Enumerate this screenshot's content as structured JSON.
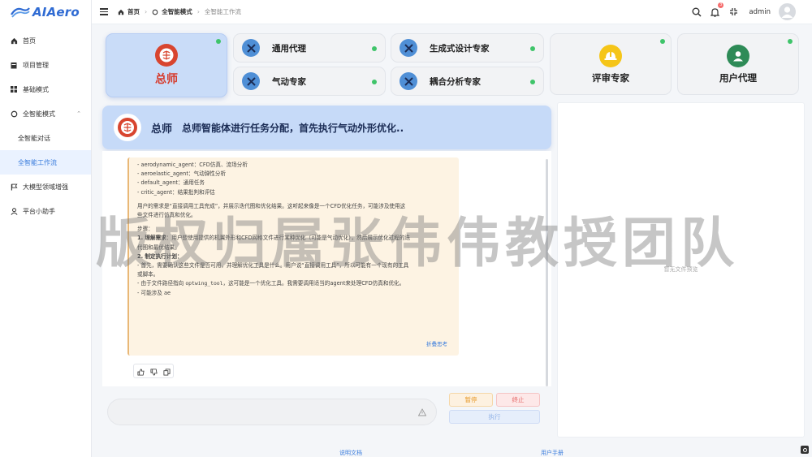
{
  "brand": {
    "name": "AIAero"
  },
  "sidebar": {
    "items": [
      {
        "label": "首页",
        "icon": "home-icon"
      },
      {
        "label": "项目管理",
        "icon": "calendar-icon"
      },
      {
        "label": "基础模式",
        "icon": "grid-icon"
      },
      {
        "label": "全智能模式",
        "icon": "circle-icon"
      },
      {
        "label": "全智能对话"
      },
      {
        "label": "全智能工作流"
      },
      {
        "label": "大模型领域增强",
        "icon": "flag-icon"
      },
      {
        "label": "平台小助手",
        "icon": "user-icon"
      }
    ]
  },
  "topbar": {
    "breadcrumbs": [
      "首页",
      "全智能模式",
      "全智能工作流"
    ],
    "notification_count": "3",
    "username": "admin"
  },
  "agents": {
    "master": "总师",
    "general": "通用代理",
    "aero": "气动专家",
    "gen_design": "生成式设计专家",
    "coupling": "耦合分析专家",
    "review": "评审专家",
    "user": "用户代理"
  },
  "chat": {
    "header_name": "总师",
    "header_text": "总师智能体进行任务分配，首先执行气动外形优化..",
    "lines": {
      "l1": "- aerodynamic_agent：CFD仿真、流场分析",
      "l2": "- aeroelastic_agent：气动弹性分析",
      "l3": "- default_agent：通用任务",
      "l4": "- critic_agent：结果批判和评估",
      "l5": "用户的需求是“直接调用工具完成”，并展示迭代图和优化结果。这听起来像是一个CFD优化任务，可能涉及使用这",
      "l6": "些文件进行仿真和优化。",
      "l7": "步骤：",
      "l8a": "1. 理解需求",
      "l8b": "：用户想使用提供的机翼外形和CFD网格文件进行某种优化（可能是气动优化），然后展示优化过程的迭",
      "l9": "代图和最优结果。",
      "l10": "2. 制定执行计划：",
      "l11": "- 首先，需要确认这些文件是否可用，并理解优化工具是什么。用户说“直接调用工具”，所以可能有一个现有的工具",
      "l12": "或脚本。",
      "l13a": "- 由于文件路径指向 ",
      "l13b": "optwing_tool",
      "l13c": "，这可能是一个优化工具。我需要调用适当的agent来处理CFD仿真和优化。",
      "l14": "- 可能涉及 ae",
      "footer": "折叠思考"
    }
  },
  "controls": {
    "input_placeholder": "",
    "pause": "暂停",
    "stop": "终止",
    "run": "执行"
  },
  "preview": {
    "placeholder": "暂无文件预览"
  },
  "footer": {
    "docs": "说明文档",
    "manual": "用户手册"
  },
  "watermark": "版权归属张伟伟教授团队",
  "colors": {
    "accent": "#3b7ddd",
    "online": "#3fc46a",
    "master_red": "#d6392a",
    "header_bg": "#c6daf8"
  }
}
